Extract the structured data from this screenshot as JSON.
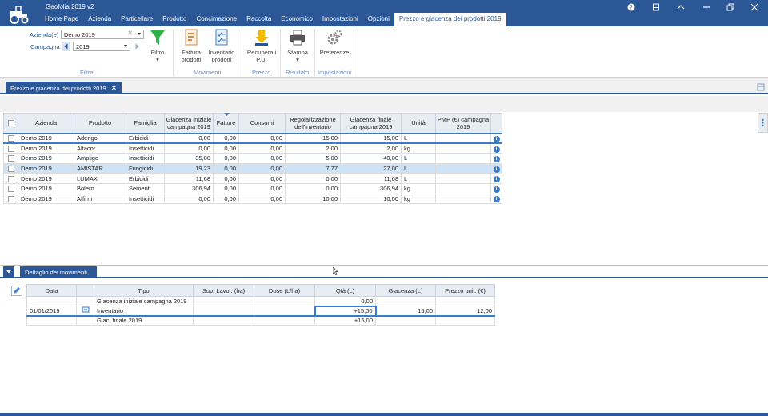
{
  "app": {
    "title": "Geofolia 2019 v2",
    "menu": [
      "Home Page",
      "Azienda",
      "Particellare",
      "Prodotto",
      "Concimazione",
      "Raccolta",
      "Economico",
      "Impostazioni",
      "Opzioni"
    ],
    "active_tab": "Prezzo e giacenza dei prodotti 2019"
  },
  "ribbon": {
    "filtra": {
      "azienda_label": "Azienda(e)",
      "azienda_value": "Demo 2019",
      "campagna_label": "Campagna",
      "campagna_value": "2019",
      "filtro_label": "Filtro",
      "group": "Filtra"
    },
    "movimenti": {
      "fattura_label": "Fattura prodotti",
      "inventario_label": "Inventario prodotti",
      "group": "Movimenti"
    },
    "prezzo": {
      "recupera_label": "Recupera i P.U.",
      "group": "Prezzo"
    },
    "risultato": {
      "stampa_label": "Stampa",
      "group": "Risultato"
    },
    "impostazioni": {
      "preferenze_label": "Preferenze",
      "group": "Impostazioni"
    }
  },
  "document_tab": {
    "label": "Prezzo e giacenza dei prodotti 2019"
  },
  "grid": {
    "columns": [
      "Azienda",
      "Prodotto",
      "Famiglia",
      "Giacenza iniziale campagna 2019",
      "Fatture",
      "Consumi",
      "Regolarizzazione dell'inventario",
      "Giacenza finale campagna 2019",
      "Unità",
      "PMP (€) campagna 2019"
    ],
    "rows": [
      [
        "Demo 2019",
        "Adengo",
        "Erbicidi",
        "0,00",
        "0,00",
        "0,00",
        "15,00",
        "15,00",
        "L",
        ""
      ],
      [
        "Demo 2019",
        "Altacor",
        "Insetticidi",
        "0,00",
        "0,00",
        "0,00",
        "2,00",
        "2,00",
        "kg",
        ""
      ],
      [
        "Demo 2019",
        "Ampligo",
        "Insetticidi",
        "35,00",
        "0,00",
        "0,00",
        "5,00",
        "40,00",
        "L",
        ""
      ],
      [
        "Demo 2019",
        "AMISTAR",
        "Fungicidi",
        "19,23",
        "0,00",
        "0,00",
        "7,77",
        "27,00",
        "L",
        ""
      ],
      [
        "Demo 2019",
        "LUMAX",
        "Erbicidi",
        "11,68",
        "0,00",
        "0,00",
        "0,00",
        "11,68",
        "L",
        ""
      ],
      [
        "Demo 2019",
        "Bolero",
        "Sementi",
        "306,94",
        "0,00",
        "0,00",
        "0,00",
        "306,94",
        "kg",
        ""
      ],
      [
        "Demo 2019",
        "Affirm",
        "Insetticidi",
        "0,00",
        "0,00",
        "0,00",
        "10,00",
        "10,00",
        "kg",
        ""
      ]
    ],
    "info_glyph": "i"
  },
  "detail_panel": {
    "tab_label": "Dettaglio dei movimenti",
    "columns": [
      "Data",
      "",
      "Tipo",
      "Sup. Lavor. (ha)",
      "Dose (L/ha)",
      "Qtà (L)",
      "Giacenza (L)",
      "Prezzo unit. (€)"
    ],
    "rows": [
      [
        "",
        "",
        "Giacenza iniziale campagna 2019",
        "",
        "",
        "0,00",
        "",
        ""
      ],
      [
        "01/01/2019",
        "",
        "Inventario",
        "",
        "",
        "+15,00",
        "15,00",
        "12,00"
      ],
      [
        "",
        "",
        "Giac. finale 2019",
        "",
        "",
        "+15,00",
        "",
        ""
      ]
    ]
  },
  "colors": {
    "brand": "#2b5797",
    "selection": "#cfe3f7",
    "focus": "#3a7ccc"
  }
}
